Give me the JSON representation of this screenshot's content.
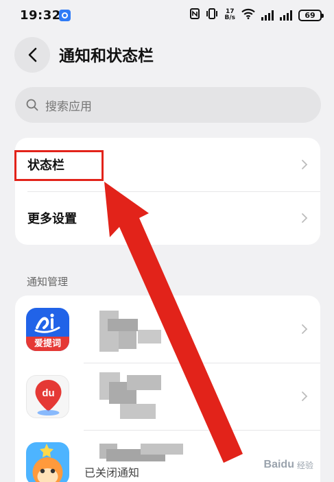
{
  "status_bar": {
    "time": "19:32",
    "net_speed_value": "17",
    "net_speed_unit": "B/s",
    "battery": "69"
  },
  "header": {
    "title": "通知和状态栏"
  },
  "search": {
    "placeholder": "搜索应用"
  },
  "settings_card": {
    "items": [
      {
        "label": "状态栏"
      },
      {
        "label": "更多设置"
      }
    ]
  },
  "notification_section": {
    "label": "通知管理",
    "apps": [
      {
        "icon_caption": "爱提词",
        "icon": "aitici-app-icon"
      },
      {
        "icon_text": "du",
        "icon": "baidu-map-app-icon"
      },
      {
        "icon": "star-monkey-app-icon",
        "status": "已关闭通知"
      }
    ]
  },
  "watermark": {
    "main": "Baidu",
    "sub": "经验"
  },
  "colors": {
    "background": "#f1f1f3",
    "card": "#ffffff",
    "annotation_red": "#e2231a",
    "aitici_blue": "#2163e8",
    "aitici_red": "#e53935"
  }
}
